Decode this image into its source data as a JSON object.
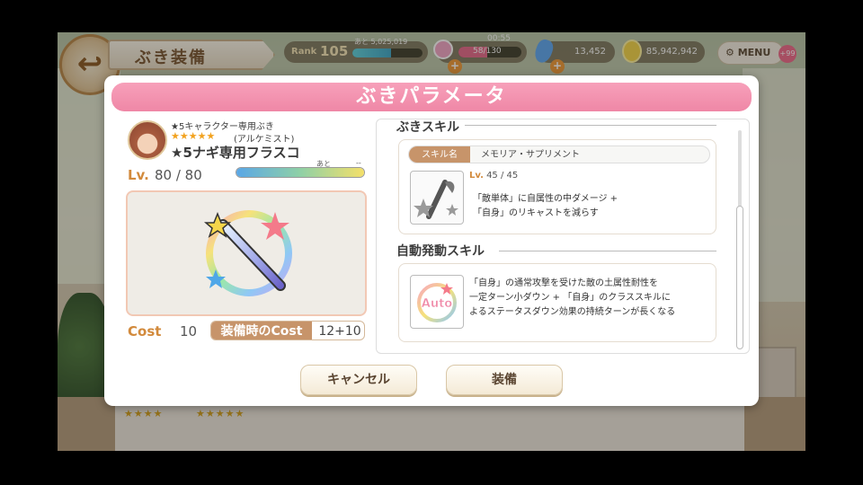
{
  "hud": {
    "screen_title": "ぶき装備",
    "rank_label": "Rank",
    "rank_value": "105",
    "rank_exp_remaining": "あと 5,025,019",
    "rank_exp_fill": 0.55,
    "stamina_timer": "00:55",
    "stamina_value": "58/130",
    "stamina_fill": 0.45,
    "gems": "13,452",
    "coins": "85,942,942",
    "menu_label": "MENU",
    "menu_badge": "+99"
  },
  "modal": {
    "title": "ぶきパラメータ",
    "weapon": {
      "subtitle": "★5キャラクター専用ぶき",
      "stars": "★★★★★",
      "class": "(アルケミスト)",
      "name": "★5ナギ専用フラスコ",
      "level_label": "Lv.",
      "level": "80 / 80",
      "exp_remaining_label": "あと",
      "exp_remaining_value": "--",
      "exp_fill": 1.0,
      "cost_label": "Cost",
      "cost": "10",
      "equip_cost_label": "装備時のCost",
      "equip_cost": "12+10"
    },
    "skills": {
      "section1_title": "ぶきスキル",
      "skill_name_tag": "スキル名",
      "skill_name": "メモリア・サプリメント",
      "skill_level_label": "Lv.",
      "skill_level": "45 / 45",
      "skill_desc_1": "「敵単体」に自属性の中ダメージ +",
      "skill_desc_2": "「自身」のリキャストを減らす",
      "section2_title": "自動発動スキル",
      "auto_icon_text": "Auto",
      "auto_desc_1": "「自身」の通常攻撃を受けた敵の土属性耐性を",
      "auto_desc_2": "一定ターン小ダウン + 「自身」のクラススキルに",
      "auto_desc_3": "よるステータスダウン効果の持続ターンが長くなる"
    },
    "buttons": {
      "cancel": "キャンセル",
      "equip": "装備"
    }
  },
  "background": {
    "list_stars_1": "★★★★",
    "list_stars_2": "★★★★★"
  },
  "colors": {
    "header_pink": "#ef87a6",
    "label_brown": "#c7946a",
    "accent_orange": "#d28a3c"
  }
}
